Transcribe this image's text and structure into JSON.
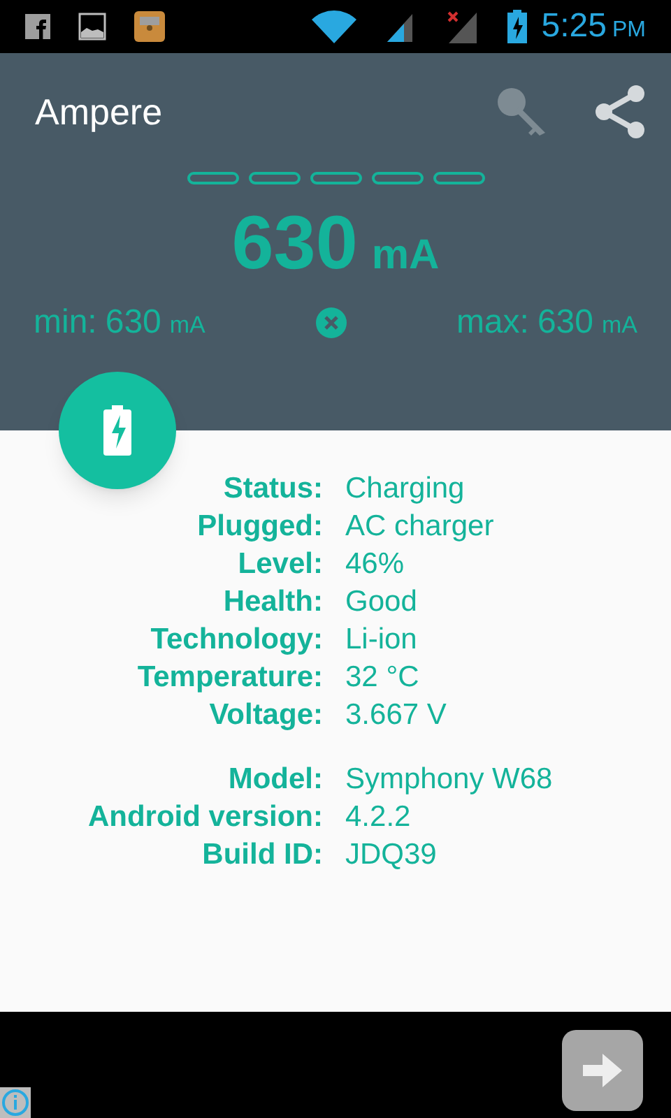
{
  "status_bar": {
    "time": "5:25",
    "ampm": "PM"
  },
  "app_bar": {
    "title": "Ampere"
  },
  "meter": {
    "segments": [
      {
        "filled": false
      },
      {
        "filled": false
      },
      {
        "filled": false
      },
      {
        "filled": false
      },
      {
        "filled": false
      }
    ],
    "value": "630",
    "unit": "mA",
    "min_label": "min:",
    "min_value": "630",
    "min_unit": "mA",
    "max_label": "max:",
    "max_value": "630",
    "max_unit": "mA"
  },
  "battery_info": [
    {
      "label": "Status:",
      "value": "Charging"
    },
    {
      "label": "Plugged:",
      "value": "AC charger"
    },
    {
      "label": "Level:",
      "value": "46%"
    },
    {
      "label": "Health:",
      "value": "Good"
    },
    {
      "label": "Technology:",
      "value": "Li-ion"
    },
    {
      "label": "Temperature:",
      "value": "32 °C"
    },
    {
      "label": "Voltage:",
      "value": "3.667 V"
    }
  ],
  "device_info": [
    {
      "label": "Model:",
      "value": "Symphony W68"
    },
    {
      "label": "Android version:",
      "value": "4.2.2"
    },
    {
      "label": "Build ID:",
      "value": "JDQ39"
    }
  ]
}
